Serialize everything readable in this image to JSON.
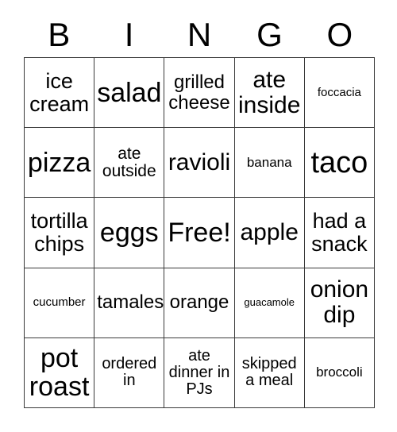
{
  "card": {
    "title": "BINGO",
    "headers": [
      "B",
      "I",
      "N",
      "G",
      "O"
    ],
    "free_space_label": "Free!",
    "colors": {
      "background": "#ffffff",
      "text": "#000000",
      "grid_line": "#3a3a3a"
    },
    "rows": [
      [
        {
          "text": "ice cream",
          "size": "fs-xl"
        },
        {
          "text": "salad",
          "size": "fs-h"
        },
        {
          "text": "grilled cheese",
          "size": "fs-l"
        },
        {
          "text": "ate inside",
          "size": "fs-xxl"
        },
        {
          "text": "foccacia",
          "size": "fs-s"
        }
      ],
      [
        {
          "text": "pizza",
          "size": "fs-h"
        },
        {
          "text": "ate outside",
          "size": "fs-ml"
        },
        {
          "text": "ravioli",
          "size": "fs-xxl"
        },
        {
          "text": "banana",
          "size": "fs-sm"
        },
        {
          "text": "taco",
          "size": "fs-hh"
        }
      ],
      [
        {
          "text": "tortilla chips",
          "size": "fs-xl"
        },
        {
          "text": "eggs",
          "size": "fs-h"
        },
        {
          "text": "Free!",
          "size": "fs-h"
        },
        {
          "text": "apple",
          "size": "fs-xxl"
        },
        {
          "text": "had a snack",
          "size": "fs-xl"
        }
      ],
      [
        {
          "text": "cucumber",
          "size": "fs-s"
        },
        {
          "text": "tamales",
          "size": "fs-l"
        },
        {
          "text": "orange",
          "size": "fs-l"
        },
        {
          "text": "guacamole",
          "size": "fs-xs"
        },
        {
          "text": "onion dip",
          "size": "fs-xxl"
        }
      ],
      [
        {
          "text": "pot roast",
          "size": "fs-h"
        },
        {
          "text": "ordered in",
          "size": "fs-m"
        },
        {
          "text": "ate dinner in PJs",
          "size": "fs-m"
        },
        {
          "text": "skipped a meal",
          "size": "fs-m"
        },
        {
          "text": "broccoli",
          "size": "fs-sm"
        }
      ]
    ]
  }
}
